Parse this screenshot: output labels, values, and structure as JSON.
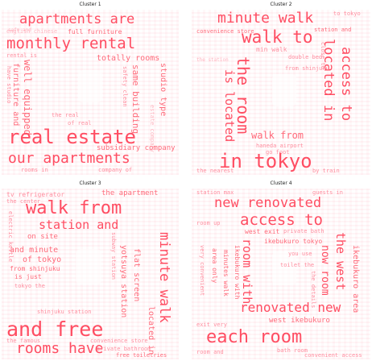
{
  "panels": [
    {
      "title": "Cluster 1",
      "words": [
        "apartments are",
        "monthly rental",
        "real estate",
        "our apartments",
        "full furniture",
        "totally rooms",
        "well equipped",
        "furniture and",
        "same building",
        "studio type",
        "subsidiary company",
        "the real",
        "safe and",
        "of real",
        "rooms in",
        "company of",
        "rental is",
        "english chinese",
        "estate company",
        "safety clean",
        "have studio"
      ]
    },
    {
      "title": "Cluster 2",
      "words": [
        "minute walk",
        "walk to",
        "the room",
        "is located",
        "access to",
        "located in",
        "walk from",
        "in tokyo",
        "convenience store",
        "min walk",
        "station and",
        "to tokyo",
        "haneda airport",
        "go foot",
        "the nearest",
        "double bed",
        "close to",
        "by train",
        "from shinjuku",
        "the station"
      ]
    },
    {
      "title": "Cluster 3",
      "words": [
        "walk from",
        "station and",
        "on site",
        "minute walk",
        "and free",
        "rooms have",
        "the apartment",
        "tv refrigerator",
        "and minute",
        "of tokyo",
        "from shinjuku",
        "is just",
        "tokyo the",
        "located in",
        "yotsuya station",
        "flat screen",
        "free toiletries",
        "electric kettle",
        "subway station",
        "shinjuku station",
        "convenience store",
        "the center",
        "private bathroom",
        "the famous"
      ]
    },
    {
      "title": "Cluster 4",
      "words": [
        "new renovated",
        "access to",
        "the west",
        "room with",
        "now room",
        "each room",
        "renovated new",
        "west exit",
        "west ikebukuro",
        "ikebukuro area",
        "area only",
        "ikebukuro tokyo",
        "private bath",
        "station max",
        "room up",
        "ikebukuro with",
        "minutes walk",
        "very convenient",
        "you use",
        "guests in",
        "toilet the",
        "exit very",
        "bath room",
        "room and",
        "convenient access",
        "the details"
      ]
    }
  ]
}
